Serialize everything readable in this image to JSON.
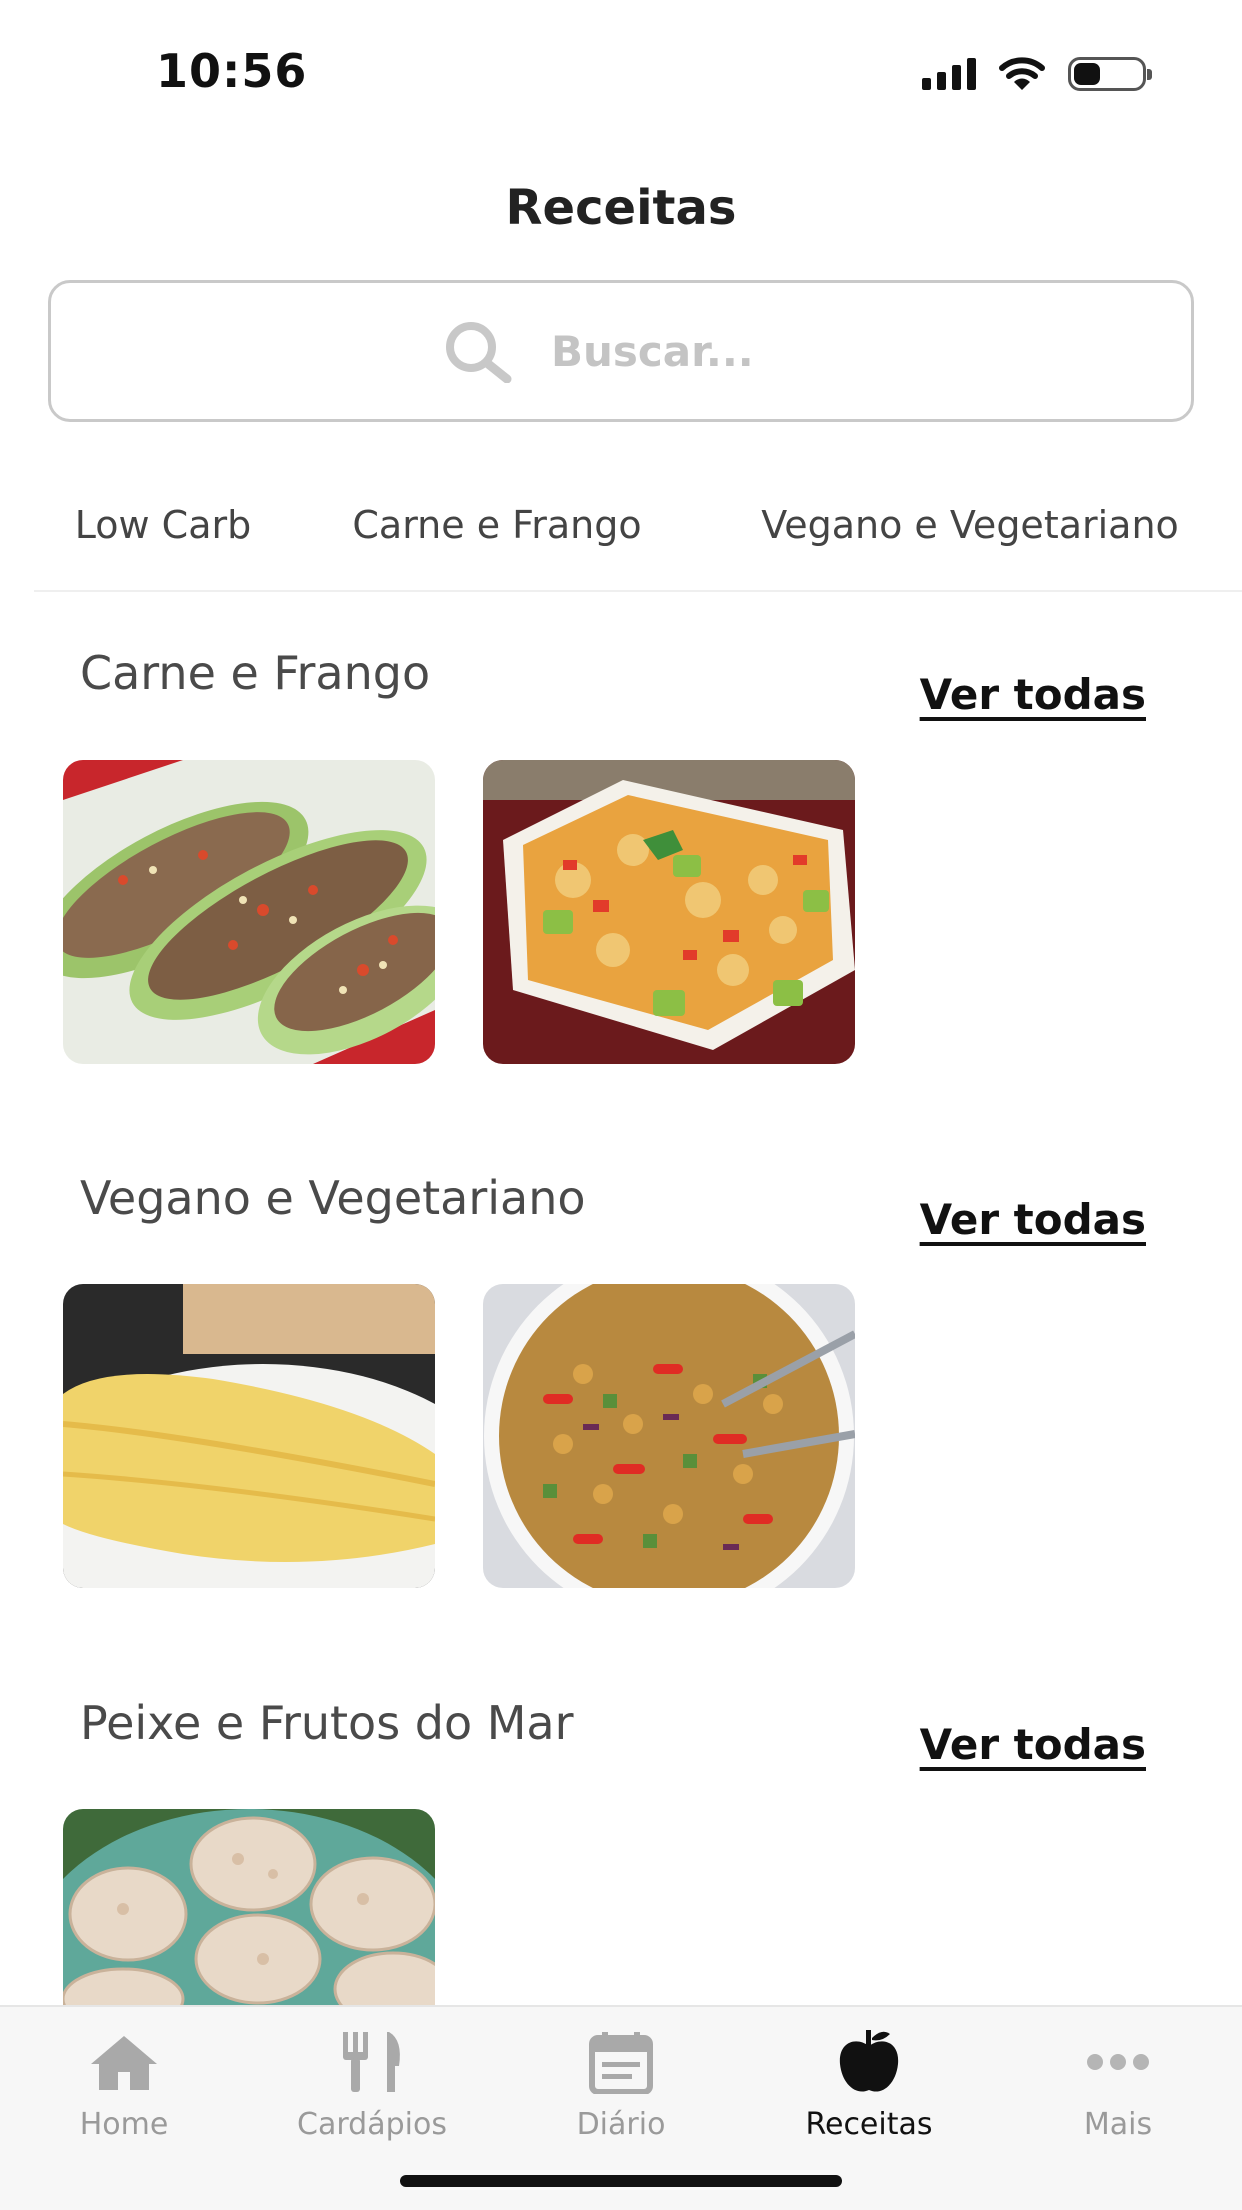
{
  "status_bar": {
    "time": "10:56",
    "icons": [
      "signal-icon",
      "wifi-icon",
      "battery-icon"
    ]
  },
  "page": {
    "title": "Receitas"
  },
  "search": {
    "placeholder": "Buscar...",
    "icon": "search-icon"
  },
  "category_tabs": [
    "Low Carb",
    "Carne e Frango",
    "Vegano e Vegetariano"
  ],
  "sections": [
    {
      "title": "Carne e Frango",
      "see_all": "Ver todas",
      "images": [
        "stuffed-zucchini-image",
        "chicken-zucchini-stirfry-image"
      ]
    },
    {
      "title": "Vegano e Vegetariano",
      "see_all": "Ver todas",
      "images": [
        "omelette-image",
        "chickpea-salad-image"
      ]
    },
    {
      "title": "Peixe e Frutos do Mar",
      "see_all": "Ver todas",
      "images": [
        "tuna-toasts-image"
      ]
    }
  ],
  "tab_bar": {
    "active": "Receitas",
    "items": [
      {
        "label": "Home",
        "icon": "home-icon"
      },
      {
        "label": "Cardápios",
        "icon": "fork-knife-icon"
      },
      {
        "label": "Diário",
        "icon": "calendar-icon"
      },
      {
        "label": "Receitas",
        "icon": "apple-icon"
      },
      {
        "label": "Mais",
        "icon": "more-dots-icon"
      }
    ]
  },
  "colors": {
    "accent": "#111111",
    "inactive": "#9a9a9a",
    "tab_bar_bg": "#f7f7f7",
    "search_border": "#c9c9c9"
  }
}
